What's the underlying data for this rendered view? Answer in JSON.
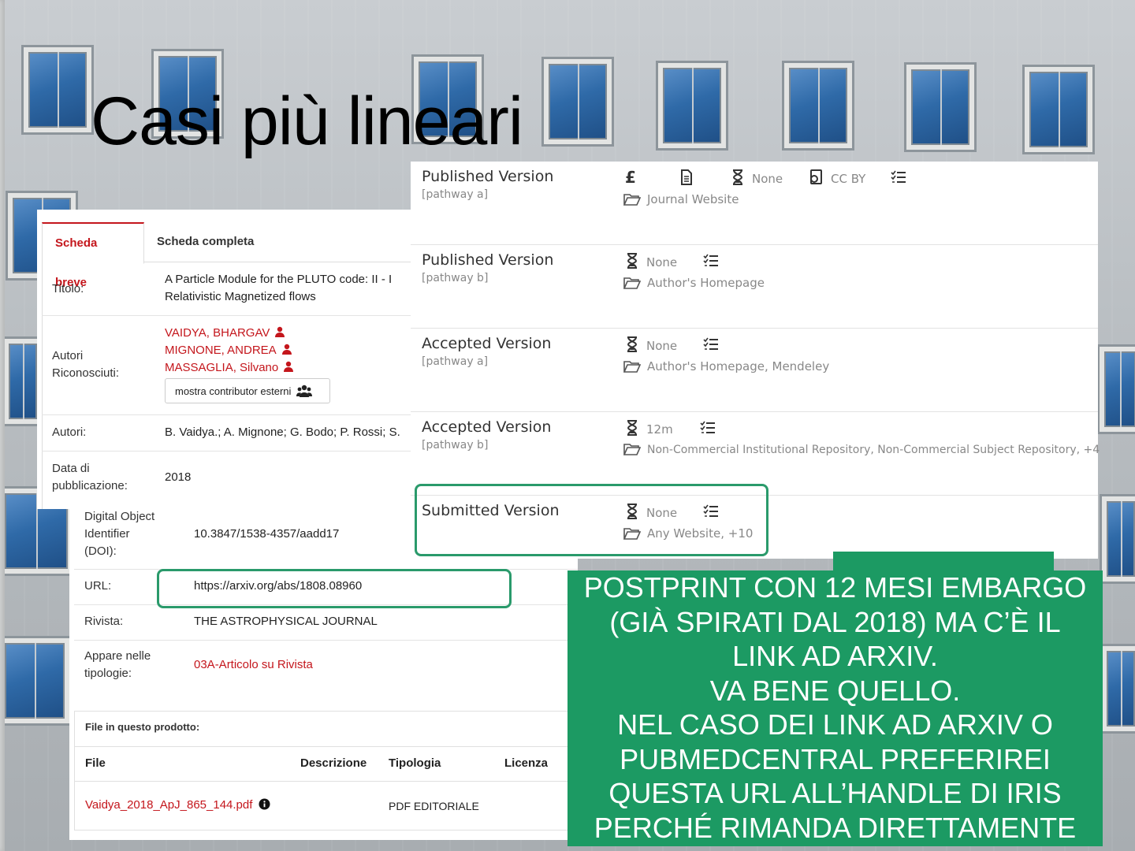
{
  "slide": {
    "title": "Casi più lineari"
  },
  "iris": {
    "tabs": {
      "short": "Scheda breve",
      "full": "Scheda completa"
    },
    "titolo": {
      "label": "Titolo:",
      "value_line1": "A Particle Module for the PLUTO code: II - I",
      "value_line2": "Relativistic Magnetized flows"
    },
    "autori_riconosciuti": {
      "label_line1": "Autori",
      "label_line2": "Riconosciuti:",
      "authors": [
        "VAIDYA, BHARGAV",
        "MIGNONE, ANDREA",
        "MASSAGLIA, Silvano"
      ],
      "external_button": "mostra contributor esterni"
    },
    "autori": {
      "label": "Autori:",
      "value": "B. Vaidya.; A. Mignone; G. Bodo; P. Rossi; S."
    },
    "data": {
      "label_line1": "Data di",
      "label_line2": "pubblicazione:",
      "value": "2018"
    },
    "doi": {
      "label_line1": "Digital Object",
      "label_line2": "Identifier",
      "label_line3": "(DOI):",
      "value": "10.3847/1538-4357/aadd17"
    },
    "url": {
      "label": "URL:",
      "value": "https://arxiv.org/abs/1808.08960"
    },
    "rivista": {
      "label": "Rivista:",
      "value": "THE ASTROPHYSICAL JOURNAL"
    },
    "tipologie": {
      "label_line1": "Appare nelle",
      "label_line2": "tipologie:",
      "value": "03A-Articolo su Rivista"
    },
    "files": {
      "heading": "File in questo prodotto:",
      "columns": [
        "File",
        "Descrizione",
        "Tipologia",
        "Licenza"
      ],
      "rows": [
        {
          "file": "Vaidya_2018_ApJ_865_144.pdf",
          "tipologia": "PDF EDITORIALE"
        }
      ]
    }
  },
  "sherpa": {
    "pathways": [
      {
        "title": "Published Version",
        "sub": "[pathway a]",
        "fee_symbol": "£",
        "embargo": "None",
        "license": "CC BY",
        "locations": "Journal Website"
      },
      {
        "title": "Published Version",
        "sub": "[pathway b]",
        "embargo": "None",
        "locations": "Author's Homepage"
      },
      {
        "title": "Accepted Version",
        "sub": "[pathway a]",
        "embargo": "None",
        "locations": "Author's Homepage, Mendeley"
      },
      {
        "title": "Accepted Version",
        "sub": "[pathway b]",
        "embargo": "12m",
        "locations": "Non-Commercial Institutional Repository, Non-Commercial Subject Repository, +4"
      },
      {
        "title": "Submitted Version",
        "sub": "",
        "embargo": "None",
        "locations": "Any Website, +10"
      }
    ]
  },
  "note": {
    "lines": [
      "POSTPRINT CON 12 MESI EMBARGO",
      "(GIÀ SPIRATI DAL 2018) MA C’È IL",
      "LINK AD ARXIV.",
      "VA BENE QUELLO.",
      "NEL CASO DEI LINK AD ARXIV O",
      "PUBMEDCENTRAL PREFERIREI",
      "QUESTA URL ALL’HANDLE DI IRIS",
      "PERCHÉ RIMANDA DIRETTAMENTE"
    ]
  },
  "colors": {
    "accent_red": "#c4161c",
    "highlight_green": "#2a9a6b",
    "note_green": "#1c9a63"
  }
}
